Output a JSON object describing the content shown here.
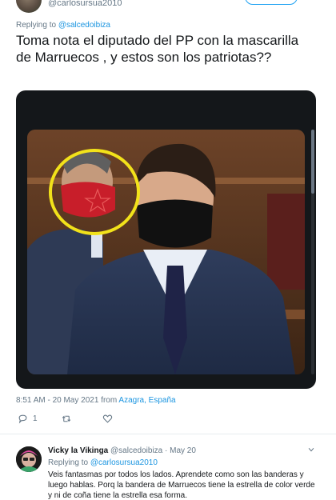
{
  "top": {
    "handle": "@carlosursua2010"
  },
  "tweet": {
    "replying_label": "Replying to",
    "replying_mention": "@salcedoibiza",
    "text": "Toma nota el diputado del PP con la mascarilla de Marruecos , y estos son los patriotas??",
    "timestamp": "8:51 AM - 20 May 2021 from",
    "location": "Azagra, España",
    "reply_count": "1",
    "retweet_count": "",
    "like_count": ""
  },
  "reply": {
    "name": "Vicky la Vikinga",
    "handle": "@salcedoibiza",
    "date": "May 20",
    "replying_label": "Replying to",
    "replying_mention": "@carlosursua2010",
    "text": "Veis fantasmas por todos los lados. Aprendete como son las banderas y luego hablas. Porq la bandera de Marruecos tiene la estrella de color verde y ni de coña tiene la estrella esa forma."
  },
  "colors": {
    "link": "#1b95e0",
    "muted": "#657786",
    "text": "#14171a",
    "annotation": "#f2e21a",
    "mask_red": "#c81e2a"
  },
  "icons": [
    "reply-icon",
    "retweet-icon",
    "like-icon",
    "chevron-down-icon"
  ]
}
